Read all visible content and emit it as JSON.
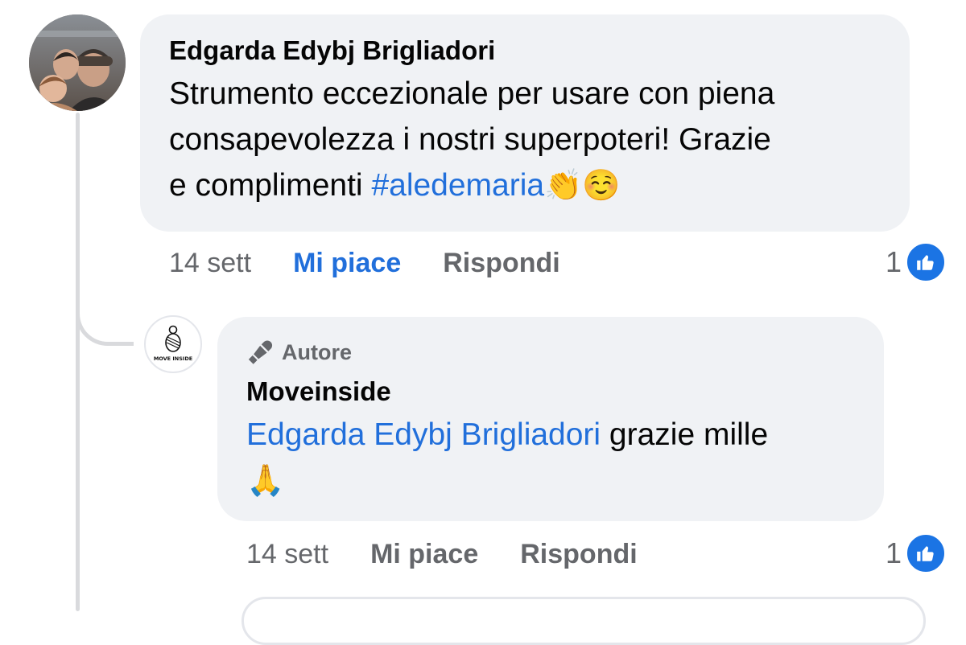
{
  "comment": {
    "author": "Edgarda Edybj Brigliadori",
    "text_lines": [
      "Strumento eccezionale per usare con piena",
      "consapevolezza i nostri superpoteri! Grazie",
      "e complimenti "
    ],
    "hashtag": "#aledemaria",
    "emojis": "👏☺️",
    "time": "14 sett",
    "like_label": "Mi piace",
    "reply_label": "Rispondi",
    "reaction_count": "1"
  },
  "reply": {
    "badge": "Autore",
    "author": "Moveinside",
    "mention": "Edgarda Edybj Brigliadori",
    "text": " grazie mille",
    "emoji": "🙏",
    "time": "14 sett",
    "like_label": "Mi piace",
    "reply_label": "Rispondi",
    "reaction_count": "1",
    "avatar_logo_text": "MOVE INSIDE"
  },
  "colors": {
    "link_blue": "#216fdb",
    "like_badge_blue": "#1b74e4",
    "bubble_bg": "#f0f2f5",
    "meta_gray": "#65676b"
  }
}
